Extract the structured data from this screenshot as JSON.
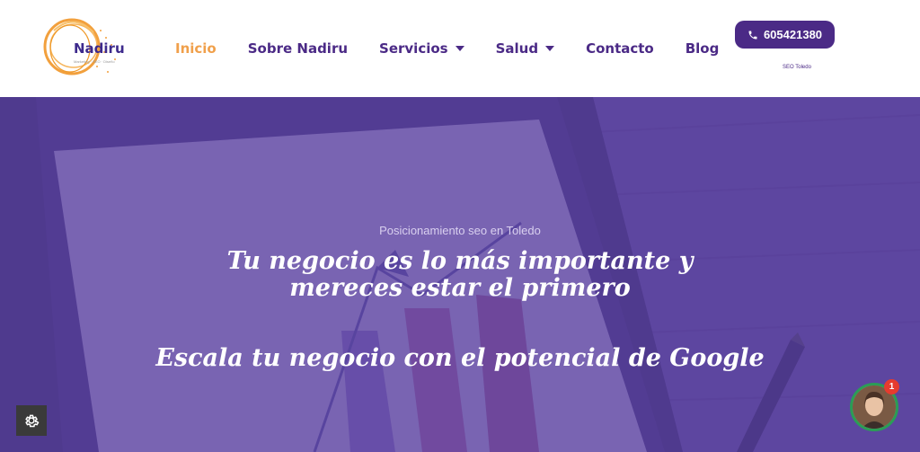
{
  "brand": {
    "name": "Nadiru",
    "tagline": "Marketing · SEO · Diseño"
  },
  "nav": {
    "items": [
      {
        "label": "Inicio",
        "active": true,
        "dropdown": false
      },
      {
        "label": "Sobre Nadiru",
        "active": false,
        "dropdown": false
      },
      {
        "label": "Servicios",
        "active": false,
        "dropdown": true
      },
      {
        "label": "Salud",
        "active": false,
        "dropdown": true
      },
      {
        "label": "Contacto",
        "active": false,
        "dropdown": false
      },
      {
        "label": "Blog",
        "active": false,
        "dropdown": false
      }
    ]
  },
  "header": {
    "phone": "605421380",
    "seo_label": "SEO Toledo"
  },
  "hero": {
    "subtitle": "Posicionamiento seo en Toledo",
    "title": "Tu negocio es lo más importante y mereces estar el primero",
    "title2": "Escala tu negocio con el potencial de Google"
  },
  "widgets": {
    "chat_badge": "1"
  },
  "colors": {
    "brand_purple": "#4b2a86",
    "accent_orange": "#f0a04b",
    "overlay": "#5a40a0"
  }
}
